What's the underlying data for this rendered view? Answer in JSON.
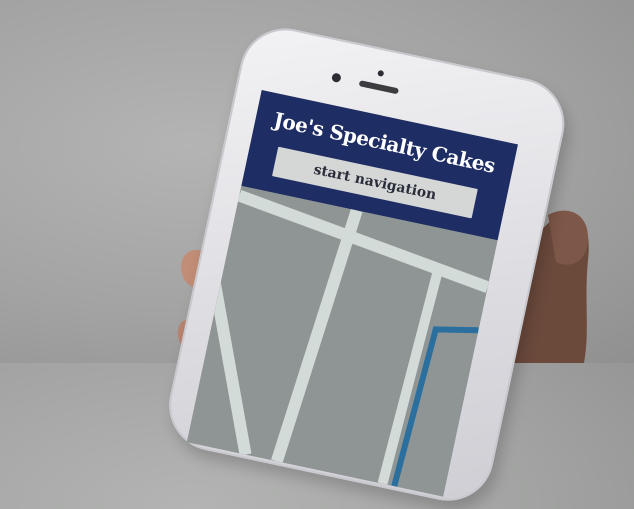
{
  "app": {
    "title": "Joe's Specialty Cakes",
    "nav_button_label": "start navigation"
  },
  "colors": {
    "header": "#1e2d63",
    "map_block": "#8e9594",
    "map_road": "#d3dbd9",
    "route": "#2a6f9e"
  },
  "icons": [
    "map-view"
  ]
}
